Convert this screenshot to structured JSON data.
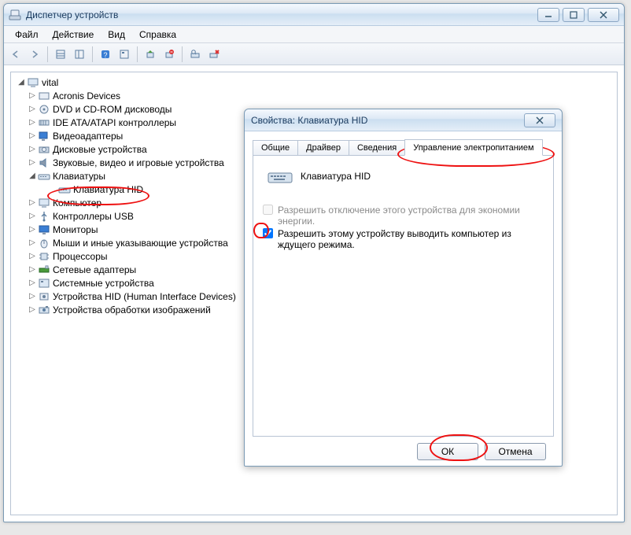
{
  "main_window": {
    "title": "Диспетчер устройств"
  },
  "menu": {
    "file": "Файл",
    "action": "Действие",
    "view": "Вид",
    "help": "Справка"
  },
  "tree": {
    "root": "vital",
    "items": [
      "Acronis Devices",
      "DVD и CD-ROM дисководы",
      "IDE ATA/ATAPI контроллеры",
      "Видеоадаптеры",
      "Дисковые устройства",
      "Звуковые, видео и игровые устройства",
      "Клавиатуры",
      "Компьютер",
      "Контроллеры USB",
      "Мониторы",
      "Мыши и иные указывающие устройства",
      "Процессоры",
      "Сетевые адаптеры",
      "Системные устройства",
      "Устройства HID (Human Interface Devices)",
      "Устройства обработки изображений"
    ],
    "keyboard_child": "Клавиатура HID"
  },
  "dialog": {
    "title": "Свойства: Клавиатура HID",
    "tabs": {
      "general": "Общие",
      "driver": "Драйвер",
      "details": "Сведения",
      "power": "Управление электропитанием"
    },
    "device_name": "Клавиатура HID",
    "check1": "Разрешить отключение этого устройства для экономии энергии.",
    "check2": "Разрешить этому устройству выводить компьютер из ждущего режима.",
    "ok": "ОК",
    "cancel": "Отмена"
  }
}
